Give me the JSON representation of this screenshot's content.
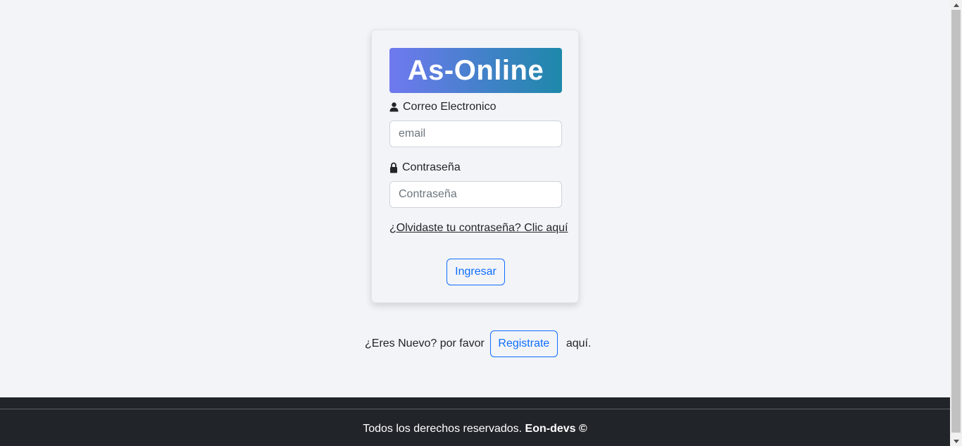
{
  "login_card": {
    "brand_title": "As-Online",
    "email": {
      "label": "Correo Electronico",
      "placeholder": "email",
      "value": "",
      "icon": "user-icon"
    },
    "password": {
      "label": "Contraseña",
      "placeholder": "Contraseña",
      "value": "",
      "icon": "lock-icon"
    },
    "forgot_link": "¿Olvidaste tu contraseña? Clic aquí",
    "submit_label": "Ingresar"
  },
  "register": {
    "prefix": "¿Eres Nuevo? por favor",
    "button_label": "Registrate",
    "suffix": "aquí."
  },
  "footer": {
    "text": "Todos los derechos reservados.",
    "brand": "Eon-devs ©"
  },
  "colors": {
    "brand_gradient_start": "#6f79ef",
    "brand_gradient_end": "#1e88aa",
    "primary": "#0d6efd",
    "footer_bg": "#212529",
    "page_bg": "#f3f4f8"
  }
}
